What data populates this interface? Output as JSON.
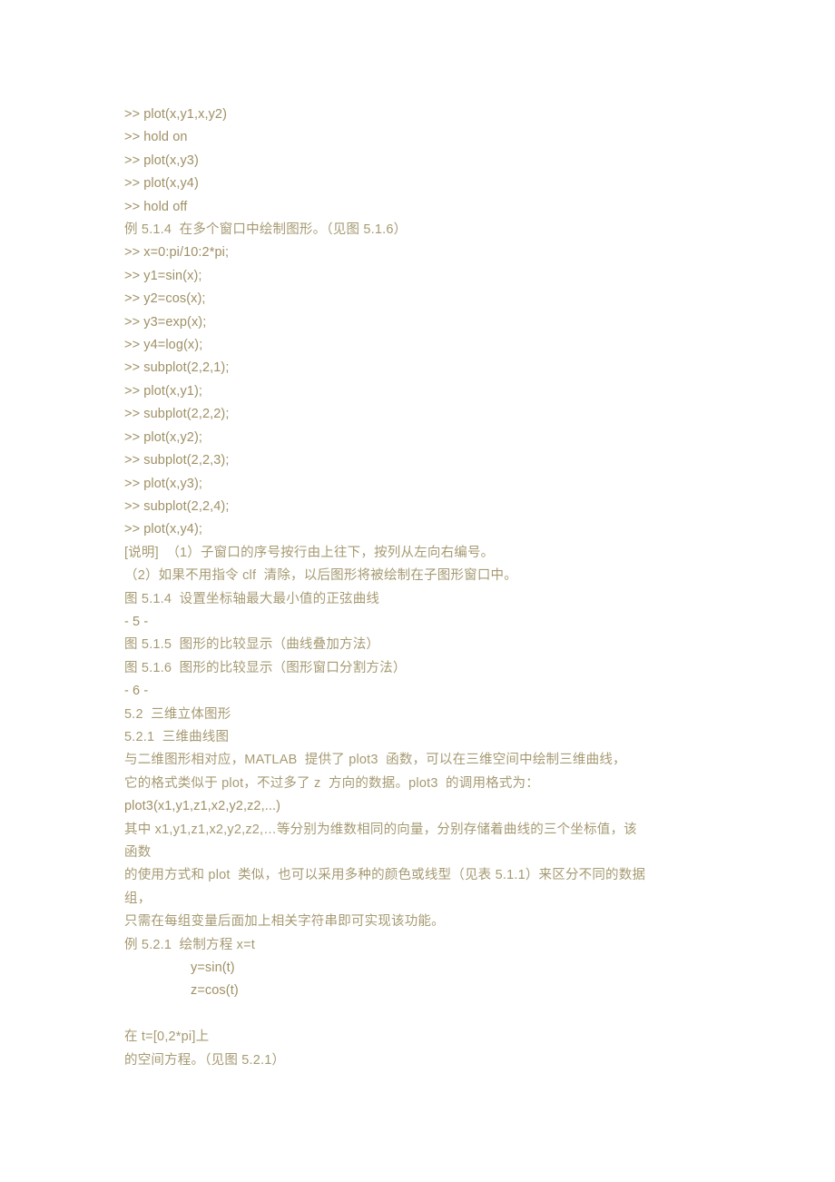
{
  "document": {
    "page_background": "#ffffff",
    "text_color_code": "#9f9065",
    "text_color_cjk": "#a69a72",
    "lines": [
      {
        "id": "l01",
        "text": ">> plot(x,y1,x,y2)",
        "kind": "code"
      },
      {
        "id": "l02",
        "text": ">> hold on",
        "kind": "code"
      },
      {
        "id": "l03",
        "text": ">> plot(x,y3)",
        "kind": "code"
      },
      {
        "id": "l04",
        "text": ">> plot(x,y4)",
        "kind": "code"
      },
      {
        "id": "l05",
        "text": ">> hold off",
        "kind": "code"
      },
      {
        "id": "l06",
        "text": "例 5.1.4  在多个窗口中绘制图形。（见图 5.1.6）",
        "kind": "cjk"
      },
      {
        "id": "l07",
        "text": ">> x=0:pi/10:2*pi;",
        "kind": "code"
      },
      {
        "id": "l08",
        "text": ">> y1=sin(x);",
        "kind": "code"
      },
      {
        "id": "l09",
        "text": ">> y2=cos(x);",
        "kind": "code"
      },
      {
        "id": "l10",
        "text": ">> y3=exp(x);",
        "kind": "code"
      },
      {
        "id": "l11",
        "text": ">> y4=log(x);",
        "kind": "code"
      },
      {
        "id": "l12",
        "text": ">> subplot(2,2,1);",
        "kind": "code"
      },
      {
        "id": "l13",
        "text": ">> plot(x,y1);",
        "kind": "code"
      },
      {
        "id": "l14",
        "text": ">> subplot(2,2,2);",
        "kind": "code"
      },
      {
        "id": "l15",
        "text": ">> plot(x,y2);",
        "kind": "code"
      },
      {
        "id": "l16",
        "text": ">> subplot(2,2,3);",
        "kind": "code"
      },
      {
        "id": "l17",
        "text": ">> plot(x,y3);",
        "kind": "code"
      },
      {
        "id": "l18",
        "text": ">> subplot(2,2,4);",
        "kind": "code"
      },
      {
        "id": "l19",
        "text": ">> plot(x,y4);",
        "kind": "code"
      },
      {
        "id": "l20",
        "text": "[说明]  （1）子窗口的序号按行由上往下，按列从左向右编号。",
        "kind": "cjk"
      },
      {
        "id": "l21",
        "text": "（2）如果不用指令 clf  清除，以后图形将被绘制在子图形窗口中。",
        "kind": "cjk"
      },
      {
        "id": "l22",
        "text": "图 5.1.4  设置坐标轴最大最小值的正弦曲线",
        "kind": "cjk"
      },
      {
        "id": "l23",
        "text": "- 5 -",
        "kind": "code"
      },
      {
        "id": "l24",
        "text": "图 5.1.5  图形的比较显示（曲线叠加方法）",
        "kind": "cjk"
      },
      {
        "id": "l25",
        "text": "图 5.1.6  图形的比较显示（图形窗口分割方法）",
        "kind": "cjk"
      },
      {
        "id": "l26",
        "text": "- 6 -",
        "kind": "code"
      },
      {
        "id": "l27",
        "text": "5.2  三维立体图形",
        "kind": "cjk"
      },
      {
        "id": "l28",
        "text": "5.2.1  三维曲线图",
        "kind": "cjk"
      },
      {
        "id": "l29",
        "text": "与二维图形相对应，MATLAB  提供了 plot3  函数，可以在三维空间中绘制三维曲线，",
        "kind": "cjk"
      },
      {
        "id": "l30",
        "text": "它的格式类似于 plot，不过多了 z  方向的数据。plot3  的调用格式为：",
        "kind": "cjk"
      },
      {
        "id": "l31",
        "text": "plot3(x1,y1,z1,x2,y2,z2,...)",
        "kind": "code"
      },
      {
        "id": "l32",
        "text": "其中 x1,y1,z1,x2,y2,z2,…等分别为维数相同的向量，分别存储着曲线的三个坐标值，该",
        "kind": "cjk"
      },
      {
        "id": "l33",
        "text": "函数",
        "kind": "cjk"
      },
      {
        "id": "l34",
        "text": "的使用方式和 plot  类似，也可以采用多种的颜色或线型（见表 5.1.1）来区分不同的数据",
        "kind": "cjk"
      },
      {
        "id": "l35",
        "text": "组，",
        "kind": "cjk"
      },
      {
        "id": "l36",
        "text": "只需在每组变量后面加上相关字符串即可实现该功能。",
        "kind": "cjk"
      },
      {
        "id": "l37",
        "text": "例 5.2.1  绘制方程 x=t",
        "kind": "cjk"
      },
      {
        "id": "l38",
        "text": "y=sin(t)",
        "kind": "code-indent"
      },
      {
        "id": "l39",
        "text": "z=cos(t)",
        "kind": "code-indent"
      },
      {
        "id": "l40",
        "text": "",
        "kind": "blank"
      },
      {
        "id": "l41",
        "text": "在 t=[0,2*pi]上",
        "kind": "cjk"
      },
      {
        "id": "l42",
        "text": "的空间方程。（见图 5.2.1）",
        "kind": "cjk"
      }
    ]
  }
}
